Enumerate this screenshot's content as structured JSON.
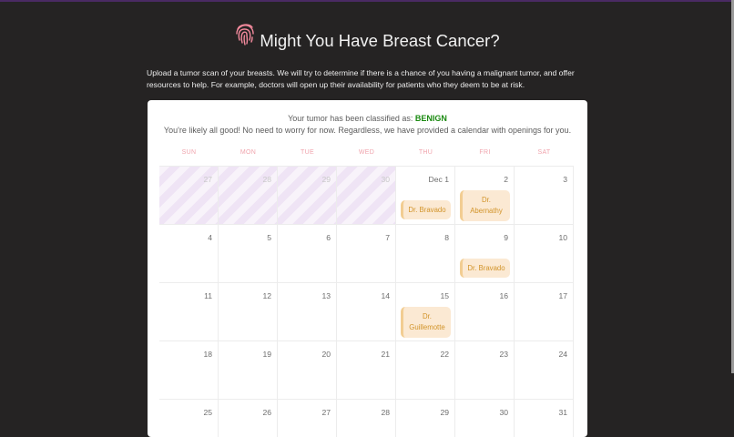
{
  "header": {
    "title": "Might You Have Breast Cancer?",
    "icon": "fingerprint-icon"
  },
  "intro_text": "Upload a tumor scan of your breasts. We will try to determine if there is a chance of you having a malignant tumor, and offer resources to help. For example, doctors will open up their availability for patients who they deem to be at risk.",
  "result": {
    "prefix": "Your tumor has been classified as:",
    "classification": "BENIGN",
    "message": "You're likely all good! No need to worry for now. Regardless, we have provided a calendar with openings for you."
  },
  "calendar": {
    "weekdays": [
      "SUN",
      "MON",
      "TUE",
      "WED",
      "THU",
      "FRI",
      "SAT"
    ],
    "weeks": [
      [
        "27",
        "28",
        "29",
        "30",
        "Dec 1",
        "2",
        "3"
      ],
      [
        "4",
        "5",
        "6",
        "7",
        "8",
        "9",
        "10"
      ],
      [
        "11",
        "12",
        "13",
        "14",
        "15",
        "16",
        "17"
      ],
      [
        "18",
        "19",
        "20",
        "21",
        "22",
        "23",
        "24"
      ],
      [
        "25",
        "26",
        "27",
        "28",
        "29",
        "30",
        "31"
      ]
    ],
    "past_days": [
      true,
      true,
      true,
      true,
      false,
      false,
      false
    ],
    "appointments": [
      {
        "week": 0,
        "day": 4,
        "doctor": "Dr. Bravado"
      },
      {
        "week": 0,
        "day": 5,
        "doctor": "Dr. Abernathy"
      },
      {
        "week": 1,
        "day": 5,
        "doctor": "Dr. Bravado"
      },
      {
        "week": 2,
        "day": 4,
        "doctor": "Dr. Guillemotte"
      }
    ]
  },
  "colors": {
    "background": "#252323",
    "benign": "#1a8a10",
    "weekday": "#f0a4ad",
    "appointment_bg": "#fbe9d3",
    "appointment_text": "#d2942a"
  }
}
